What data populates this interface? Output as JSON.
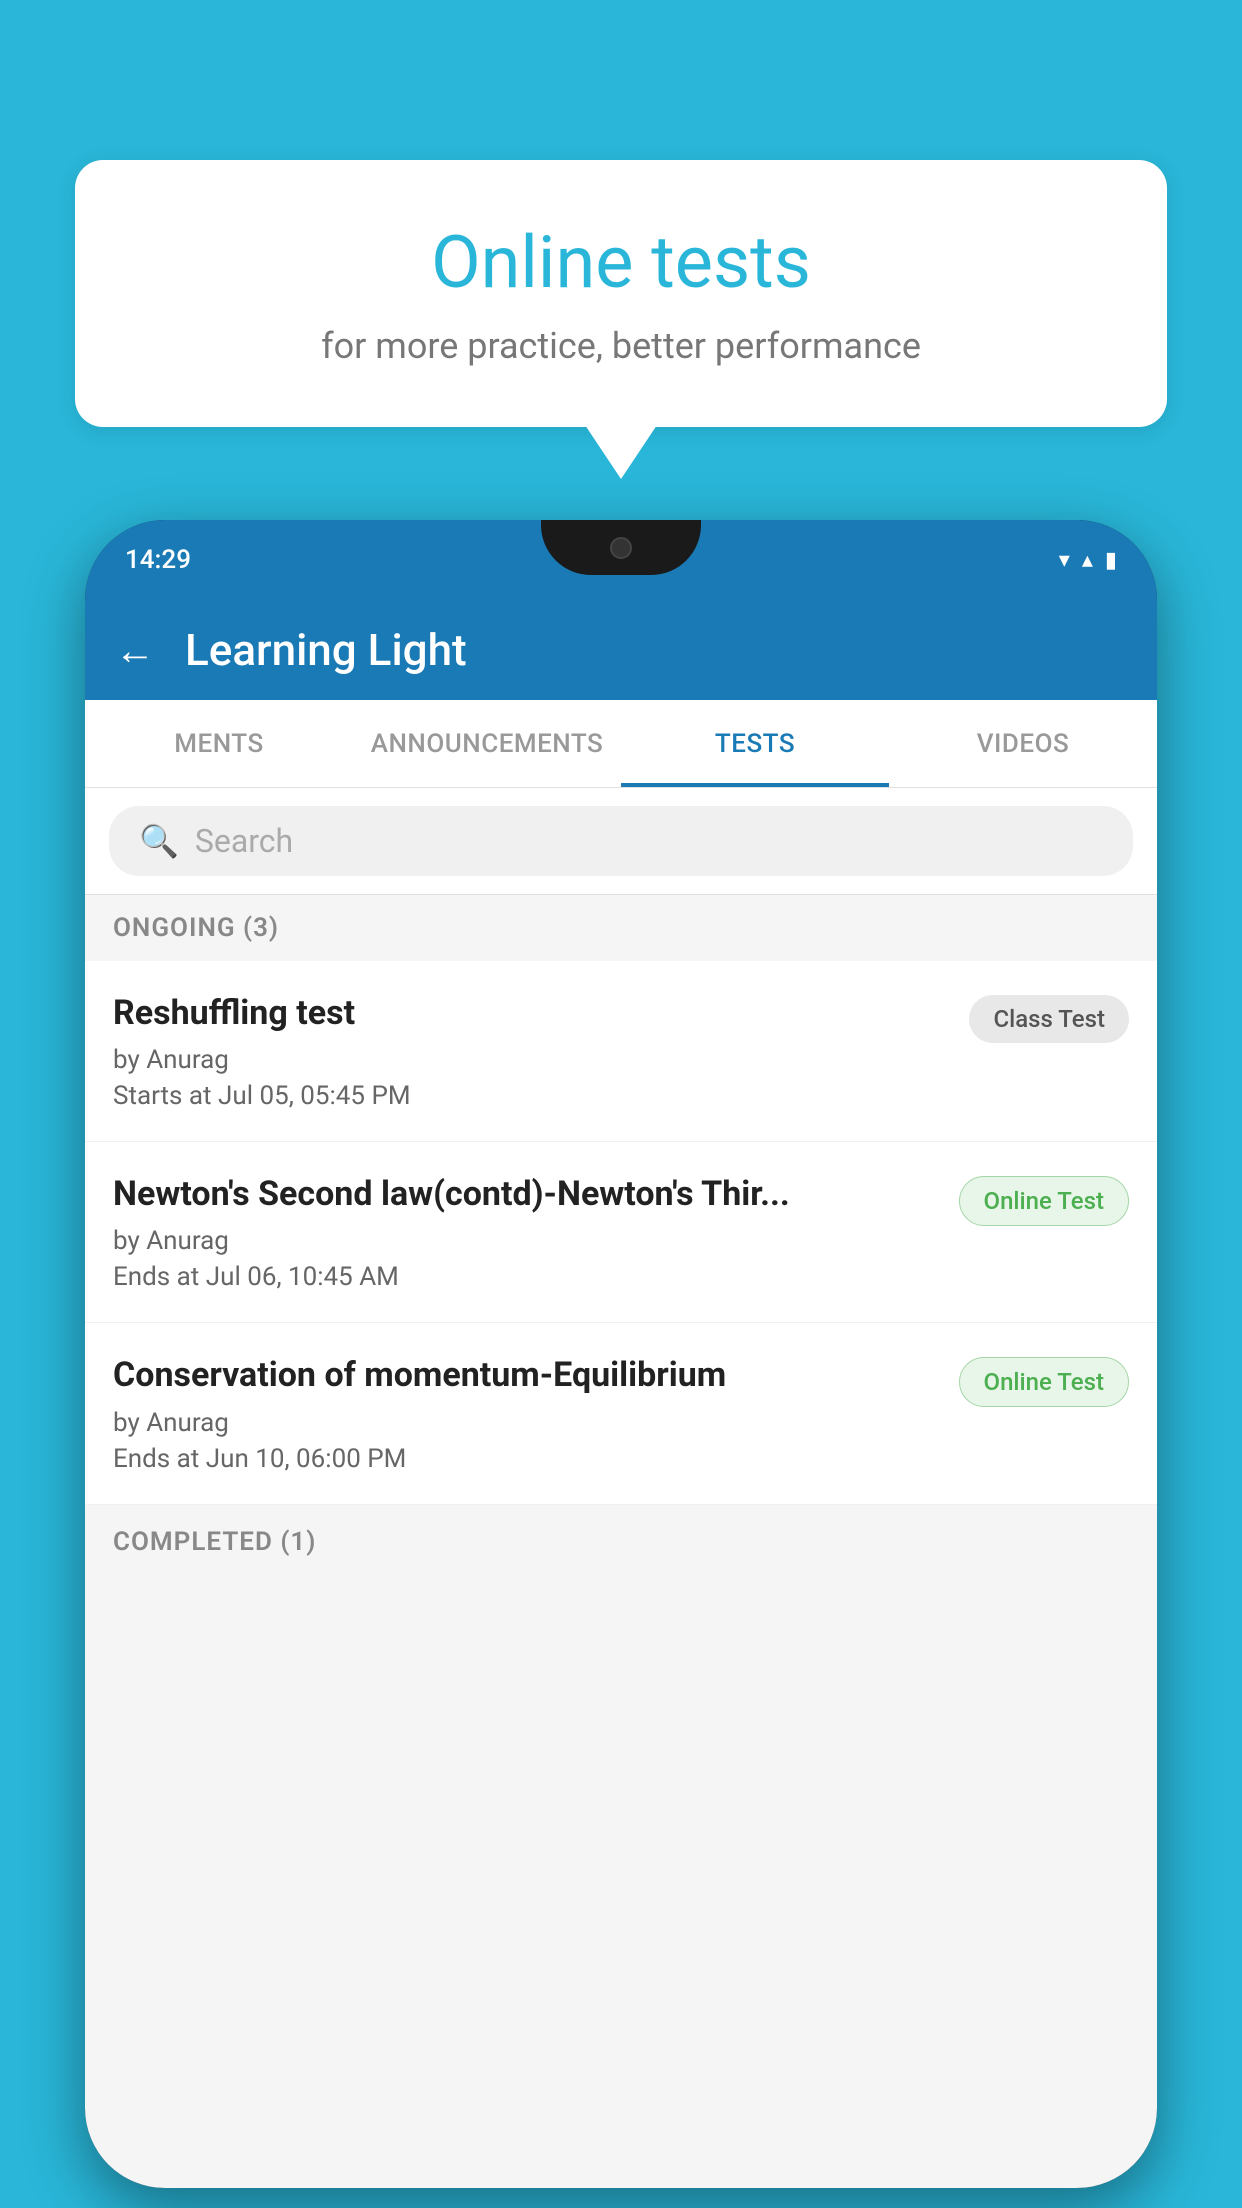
{
  "background": {
    "color": "#29b6d8"
  },
  "speech_bubble": {
    "title": "Online tests",
    "subtitle": "for more practice, better performance"
  },
  "phone": {
    "status_bar": {
      "time": "14:29",
      "wifi_icon": "▼",
      "signal_icon": "▲",
      "battery_icon": "▮"
    },
    "app_bar": {
      "back_label": "←",
      "title": "Learning Light"
    },
    "tabs": [
      {
        "label": "MENTS",
        "active": false
      },
      {
        "label": "ANNOUNCEMENTS",
        "active": false
      },
      {
        "label": "TESTS",
        "active": true
      },
      {
        "label": "VIDEOS",
        "active": false
      }
    ],
    "search": {
      "placeholder": "Search"
    },
    "ongoing_section": {
      "label": "ONGOING (3)"
    },
    "tests": [
      {
        "title": "Reshuffling test",
        "author": "by Anurag",
        "date_label": "Starts at",
        "date": "Jul 05, 05:45 PM",
        "badge": "Class Test",
        "badge_type": "class"
      },
      {
        "title": "Newton's Second law(contd)-Newton's Thir...",
        "author": "by Anurag",
        "date_label": "Ends at",
        "date": "Jul 06, 10:45 AM",
        "badge": "Online Test",
        "badge_type": "online"
      },
      {
        "title": "Conservation of momentum-Equilibrium",
        "author": "by Anurag",
        "date_label": "Ends at",
        "date": "Jun 10, 06:00 PM",
        "badge": "Online Test",
        "badge_type": "online"
      }
    ],
    "completed_section": {
      "label": "COMPLETED (1)"
    }
  }
}
